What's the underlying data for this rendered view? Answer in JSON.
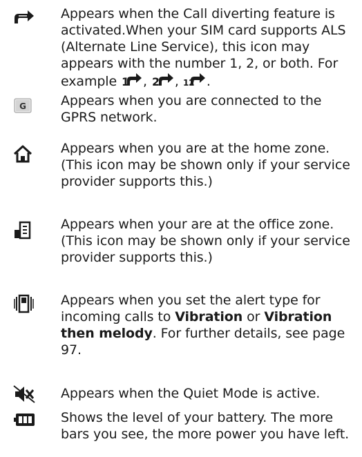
{
  "entries": [
    {
      "icon": "call-divert-icon",
      "text_pre": "Appears when the Call diverting feature is activated.When your SIM card supports ALS (Alternate Line Service), this icon may appears with the number 1, 2, or both. For example ",
      "sep1": ", ",
      "sep2": ", ",
      "text_end": "."
    },
    {
      "icon": "gprs-icon",
      "icon_letter": "G",
      "text": "Appears when you are connected to the GPRS network."
    },
    {
      "icon": "home-zone-icon",
      "text": "Appears when you are at the home zone. (This icon may be shown only if your service provider supports this.)"
    },
    {
      "icon": "office-zone-icon",
      "text": "Appears when your are at the office zone. (This icon may be shown only if your service provider supports this.)"
    },
    {
      "icon": "vibration-icon",
      "text_a": "Appears when you set the alert type for incoming calls to ",
      "bold_a": "Vibration",
      "text_b": " or ",
      "bold_b": "Vibration then melody",
      "text_c": ". For further details, see page 97."
    },
    {
      "icon": "quiet-mode-icon",
      "text": "Appears when the Quiet Mode is active."
    },
    {
      "icon": "battery-icon",
      "text": "Shows the level of your battery. The more bars you see, the more power you have left."
    }
  ],
  "inline_icons": [
    "line-1-divert-icon",
    "line-2-divert-icon",
    "both-lines-divert-icon"
  ],
  "inline_labels": [
    "1",
    "2",
    "12"
  ]
}
